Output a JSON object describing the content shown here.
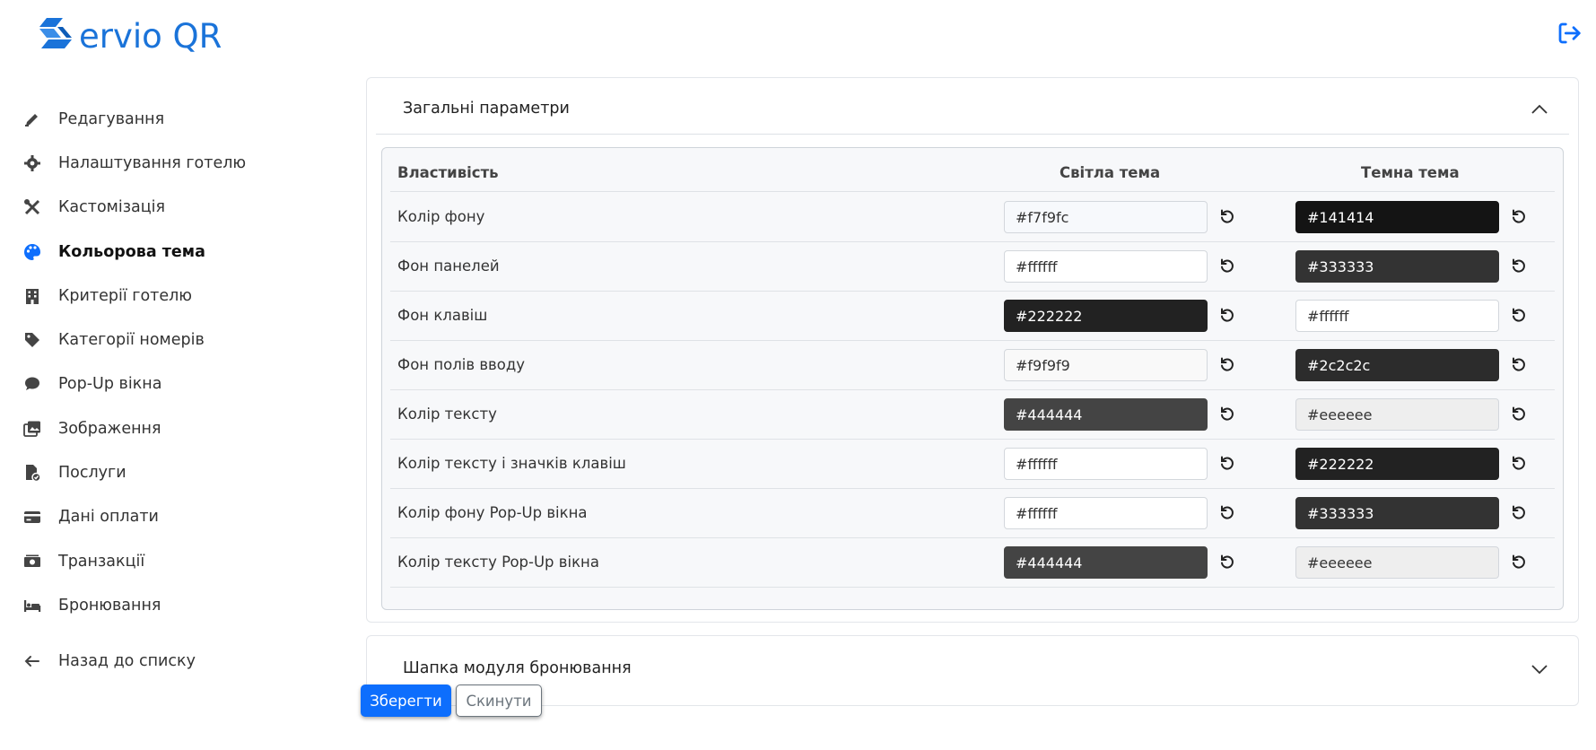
{
  "app": {
    "logo_text": "ervio QR"
  },
  "sidebar": {
    "items": [
      {
        "label": "Редагування",
        "icon": "pencil-icon"
      },
      {
        "label": "Налаштування готелю",
        "icon": "gear-icon"
      },
      {
        "label": "Кастомізація",
        "icon": "tools-icon"
      },
      {
        "label": "Кольорова тема",
        "icon": "palette-icon",
        "active": true
      },
      {
        "label": "Критерії готелю",
        "icon": "building-icon"
      },
      {
        "label": "Категорії номерів",
        "icon": "tag-icon"
      },
      {
        "label": "Pop-Up вікна",
        "icon": "chat-bubble-icon"
      },
      {
        "label": "Зображення",
        "icon": "images-icon"
      },
      {
        "label": "Послуги",
        "icon": "file-check-icon"
      },
      {
        "label": "Дані оплати",
        "icon": "credit-card-icon"
      },
      {
        "label": "Транзакції",
        "icon": "money-icon"
      },
      {
        "label": "Бронювання",
        "icon": "bed-icon"
      }
    ],
    "back_label": "Назад до списку"
  },
  "general": {
    "title": "Загальні параметри",
    "headers": {
      "property": "Властивість",
      "light": "Світла тема",
      "dark": "Темна тема"
    },
    "rows": [
      {
        "property": "Колір фону",
        "light": "#f7f9fc",
        "dark": "#141414"
      },
      {
        "property": "Фон панелей",
        "light": "#ffffff",
        "dark": "#333333"
      },
      {
        "property": "Фон клавіш",
        "light": "#222222",
        "dark": "#ffffff"
      },
      {
        "property": "Фон полів вводу",
        "light": "#f9f9f9",
        "dark": "#2c2c2c"
      },
      {
        "property": "Колір тексту",
        "light": "#444444",
        "dark": "#eeeeee"
      },
      {
        "property": "Колір тексту і значків клавіш",
        "light": "#ffffff",
        "dark": "#222222"
      },
      {
        "property": "Колір фону Pop-Up вікна",
        "light": "#ffffff",
        "dark": "#333333"
      },
      {
        "property": "Колір тексту Pop-Up вікна",
        "light": "#444444",
        "dark": "#eeeeee"
      }
    ]
  },
  "booking_header": {
    "title": "Шапка модуля бронювання"
  },
  "actions": {
    "save_label": "Зберегти",
    "reset_label": "Скинути"
  },
  "colors": {
    "accent": "#0d6efd",
    "logo": "#1a73d9"
  }
}
